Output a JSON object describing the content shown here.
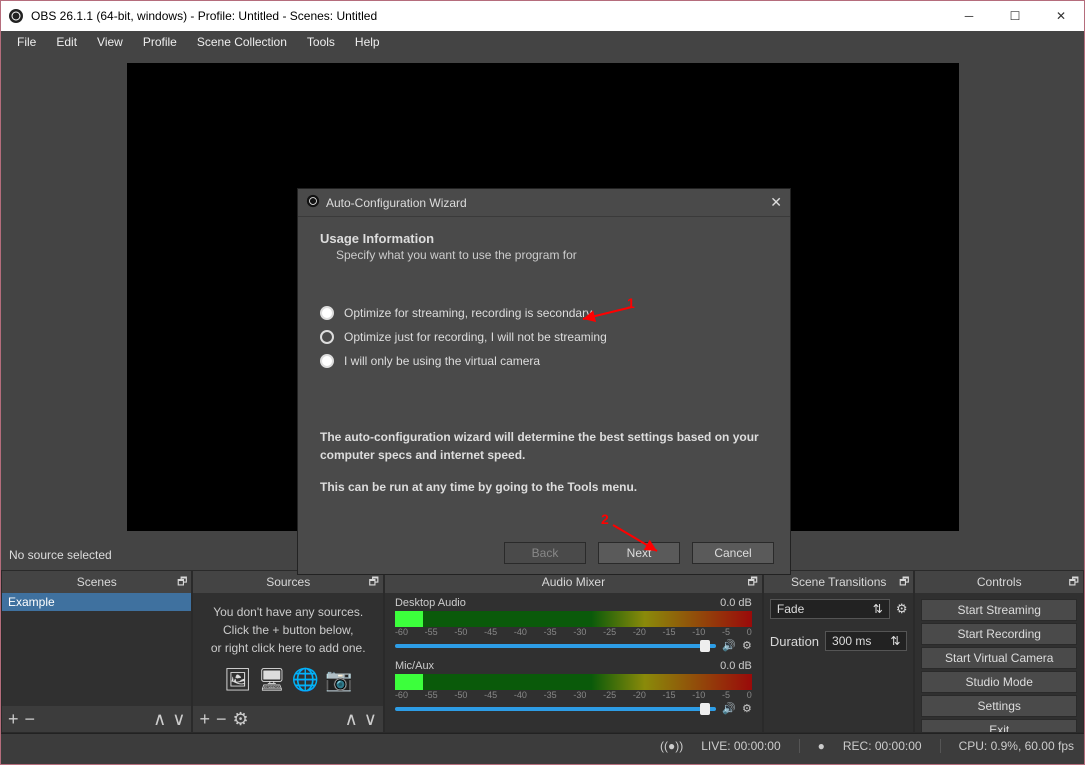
{
  "window": {
    "title": "OBS 26.1.1 (64-bit, windows) - Profile: Untitled - Scenes: Untitled"
  },
  "menu": [
    "File",
    "Edit",
    "View",
    "Profile",
    "Scene Collection",
    "Tools",
    "Help"
  ],
  "sourcebar": {
    "text": "No source selected"
  },
  "panels": {
    "scenes": {
      "title": "Scenes",
      "items": [
        "Example"
      ]
    },
    "sources": {
      "title": "Sources",
      "empty_l1": "You don't have any sources.",
      "empty_l2": "Click the + button below,",
      "empty_l3": "or right click here to add one."
    },
    "audio": {
      "title": "Audio Mixer",
      "channels": [
        {
          "name": "Desktop Audio",
          "db": "0.0 dB"
        },
        {
          "name": "Mic/Aux",
          "db": "0.0 dB"
        }
      ],
      "ticks": [
        "-60",
        "-55",
        "-50",
        "-45",
        "-40",
        "-35",
        "-30",
        "-25",
        "-20",
        "-15",
        "-10",
        "-5",
        "0"
      ]
    },
    "transitions": {
      "title": "Scene Transitions",
      "value": "Fade",
      "dur_label": "Duration",
      "dur_value": "300 ms"
    },
    "controls": {
      "title": "Controls",
      "buttons": [
        "Start Streaming",
        "Start Recording",
        "Start Virtual Camera",
        "Studio Mode",
        "Settings",
        "Exit"
      ]
    }
  },
  "status": {
    "live": "LIVE: 00:00:00",
    "rec": "REC: 00:00:00",
    "cpu": "CPU: 0.9%, 60.00 fps"
  },
  "dialog": {
    "title": "Auto-Configuration Wizard",
    "heading": "Usage Information",
    "sub": "Specify what you want to use the program for",
    "opt1": "Optimize for streaming, recording is secondary",
    "opt2": "Optimize just for recording, I will not be streaming",
    "opt3": "I will only be using the virtual camera",
    "para1": "The auto-configuration wizard will determine the best settings based on your computer specs and internet speed.",
    "para2": "This can be run at any time by going to the Tools menu.",
    "back": "Back",
    "next": "Next",
    "cancel": "Cancel"
  },
  "annot": {
    "a1": "1",
    "a2": "2"
  }
}
